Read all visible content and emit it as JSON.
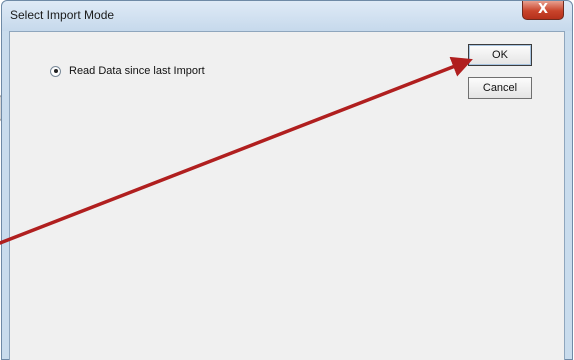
{
  "window": {
    "title": "Select Import Mode",
    "close_label": "X"
  },
  "options": {
    "read_data_label": "Read Data since last Import",
    "read_data_selected": true
  },
  "buttons": {
    "ok_label": "OK",
    "cancel_label": "Cancel"
  },
  "colors": {
    "annotation_arrow": "#b01f1f",
    "title_bar": "#c9dced",
    "dialog_body": "#f0f0f0",
    "close_button": "#c9442b"
  },
  "icons": {
    "close": "close-icon",
    "radio": "radio-selected-icon",
    "annotation": "red-arrow-icon"
  }
}
